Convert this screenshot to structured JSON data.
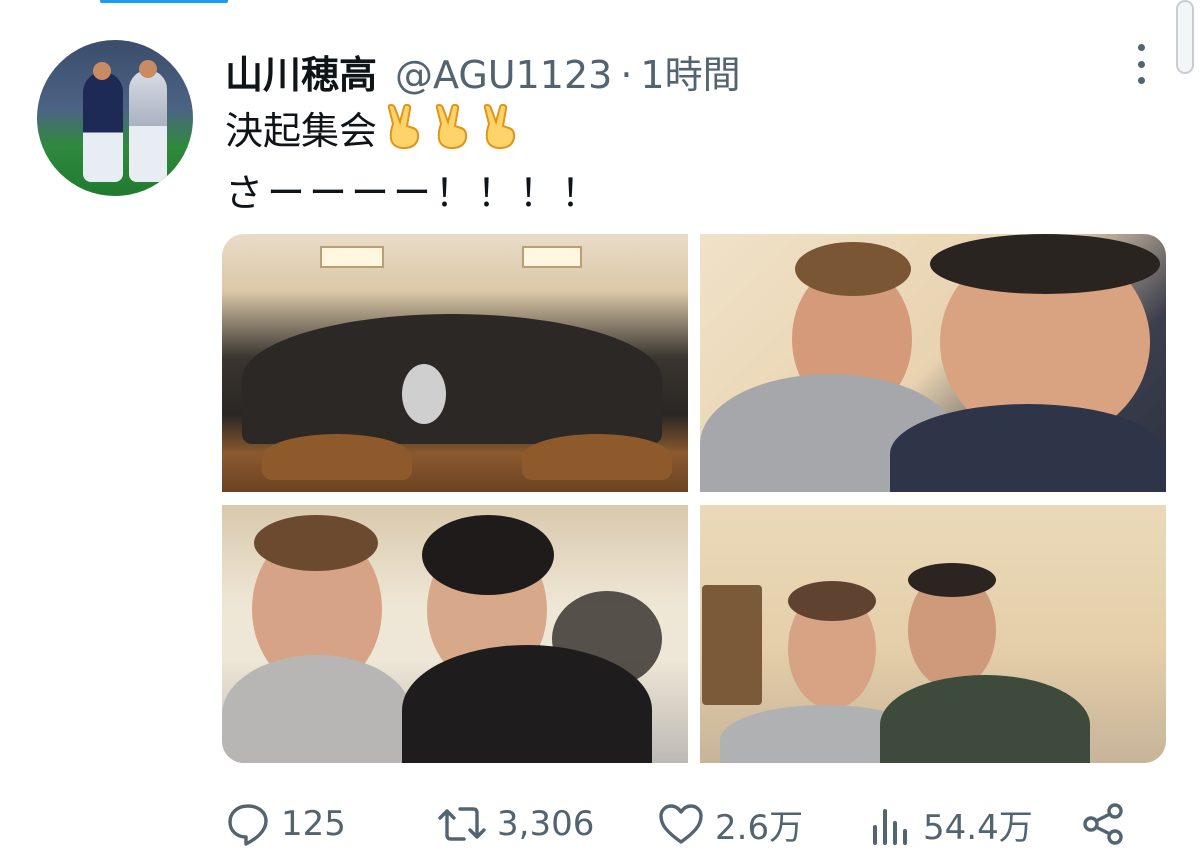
{
  "tweet": {
    "display_name": "山川穂高",
    "handle": "@AGU1123",
    "separator": "·",
    "time": "1時間",
    "line1_text": "決起集会",
    "line1_emojis": [
      "victory-hand",
      "victory-hand",
      "victory-hand"
    ],
    "line2_text": "さーーーー！！！！"
  },
  "actions": {
    "replies": "125",
    "retweets": "3,306",
    "likes": "2.6万",
    "views": "54.4万"
  },
  "colors": {
    "accent": "#1d9bf0",
    "text": "#0f1419",
    "secondary": "#536471",
    "emoji": "#f5a623"
  },
  "icons": [
    "reply-icon",
    "retweet-icon",
    "like-icon",
    "views-icon",
    "share-icon",
    "more-icon"
  ],
  "media": [
    "group-dinner-photo",
    "selfie-two-men-photo",
    "selfie-calligraphy-wall-photo",
    "selfie-hallway-photo"
  ]
}
